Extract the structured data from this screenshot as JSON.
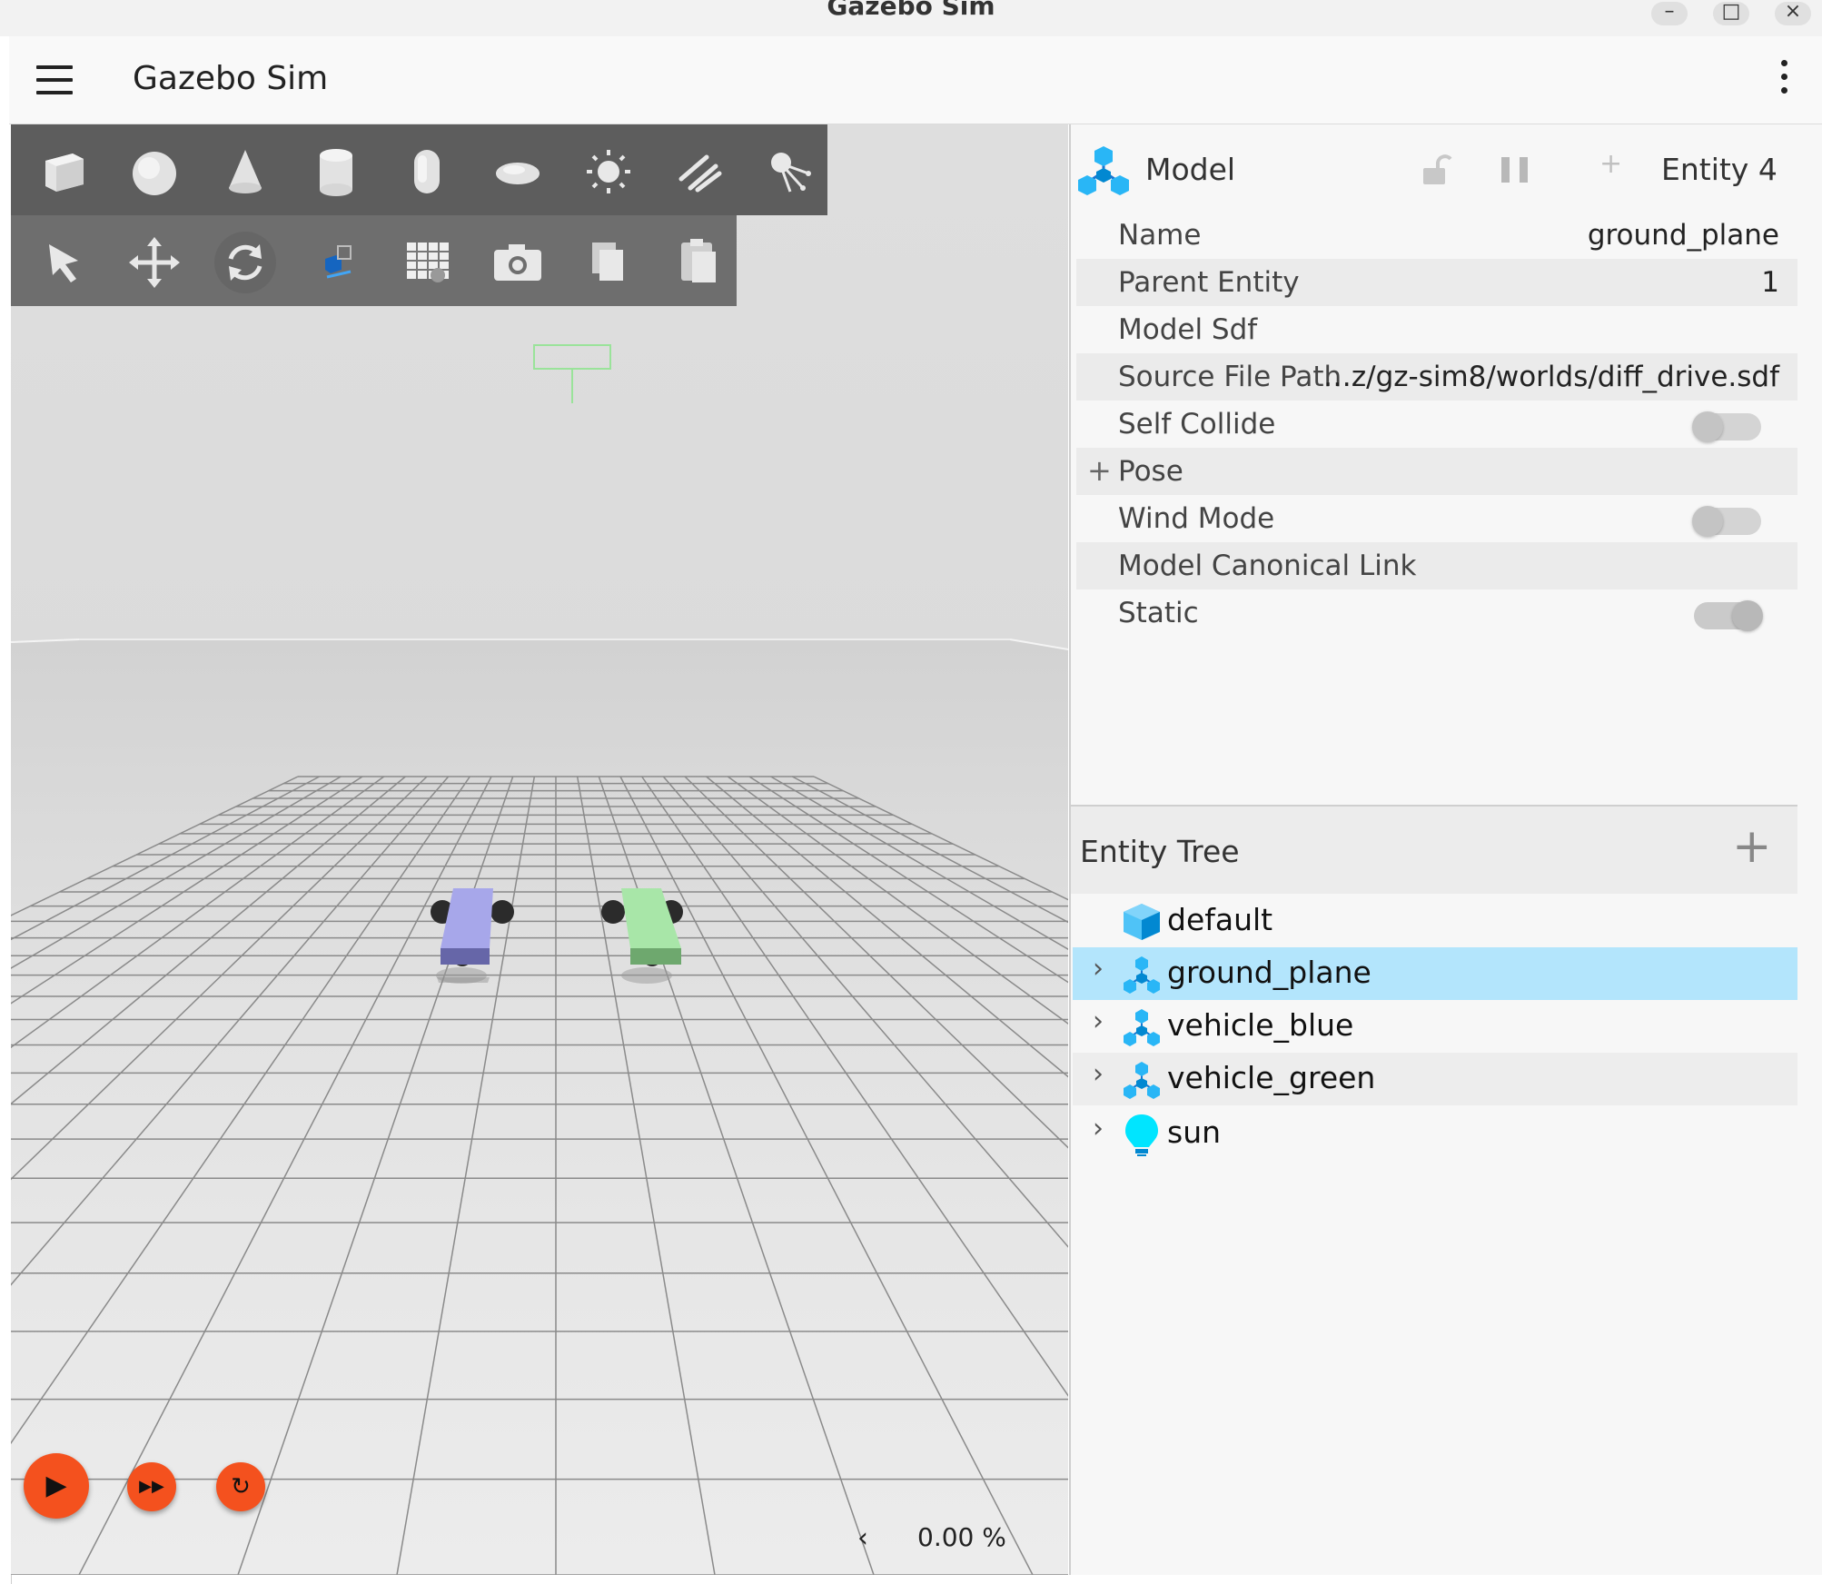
{
  "window": {
    "title": "Gazebo Sim",
    "minimize_glyph": "–",
    "maximize_glyph": "□",
    "close_glyph": "×"
  },
  "app": {
    "title": "Gazebo Sim",
    "menu_icon": "hamburger-menu-icon",
    "options_icon": "kebab-menu-icon"
  },
  "shape_toolbar": {
    "items": [
      "box-icon",
      "sphere-icon",
      "cone-icon",
      "cylinder-icon",
      "capsule-icon",
      "ellipsoid-icon",
      "directional-light-icon",
      "point-light-icon",
      "spot-light-icon"
    ]
  },
  "tool_toolbar": {
    "items": [
      "select-arrow-icon",
      "translate-icon",
      "rotate-icon",
      "snap-icon",
      "grid-config-icon",
      "screenshot-icon",
      "copy-icon",
      "paste-icon"
    ]
  },
  "playback": {
    "play_glyph": "▶",
    "step_glyph": "▶▶",
    "reset_glyph": "↻",
    "rtf_prefix": "‹",
    "rtf_value": "0.00 %"
  },
  "component_inspector": {
    "type_label": "Model",
    "entity_label": "Entity 4",
    "plus_glyph": "+",
    "rows": [
      {
        "label": "Name",
        "value": "ground_plane"
      },
      {
        "label": "Parent Entity",
        "value": "1"
      },
      {
        "label": "Model Sdf",
        "value": ""
      },
      {
        "label": "Source File Path",
        "value": "…z/gz-sim8/worlds/diff_drive.sdf"
      },
      {
        "label": "Self Collide",
        "toggle": false
      },
      {
        "label": "Pose",
        "value": ""
      },
      {
        "label": "Wind Mode",
        "toggle": false
      },
      {
        "label": "Model Canonical Link",
        "value": ""
      },
      {
        "label": "Static",
        "toggle": true
      }
    ],
    "pose_expand_glyph": "+"
  },
  "entity_tree": {
    "title": "Entity Tree",
    "add_glyph": "+",
    "chevron": "›",
    "items": [
      {
        "name": "default",
        "icon": "world-cube-icon",
        "selected": false
      },
      {
        "name": "ground_plane",
        "icon": "model-icon",
        "selected": true
      },
      {
        "name": "vehicle_blue",
        "icon": "model-icon",
        "selected": false
      },
      {
        "name": "vehicle_green",
        "icon": "model-icon",
        "selected": false
      },
      {
        "name": "sun",
        "icon": "light-bulb-icon",
        "selected": false
      }
    ]
  },
  "colors": {
    "accent_orange": "#f4511e",
    "selection_blue": "#b3e5fc",
    "vehicle_blue": "#a8a8e8",
    "vehicle_green": "#a8e6a8",
    "model_icon_blue": "#29b6f6"
  }
}
